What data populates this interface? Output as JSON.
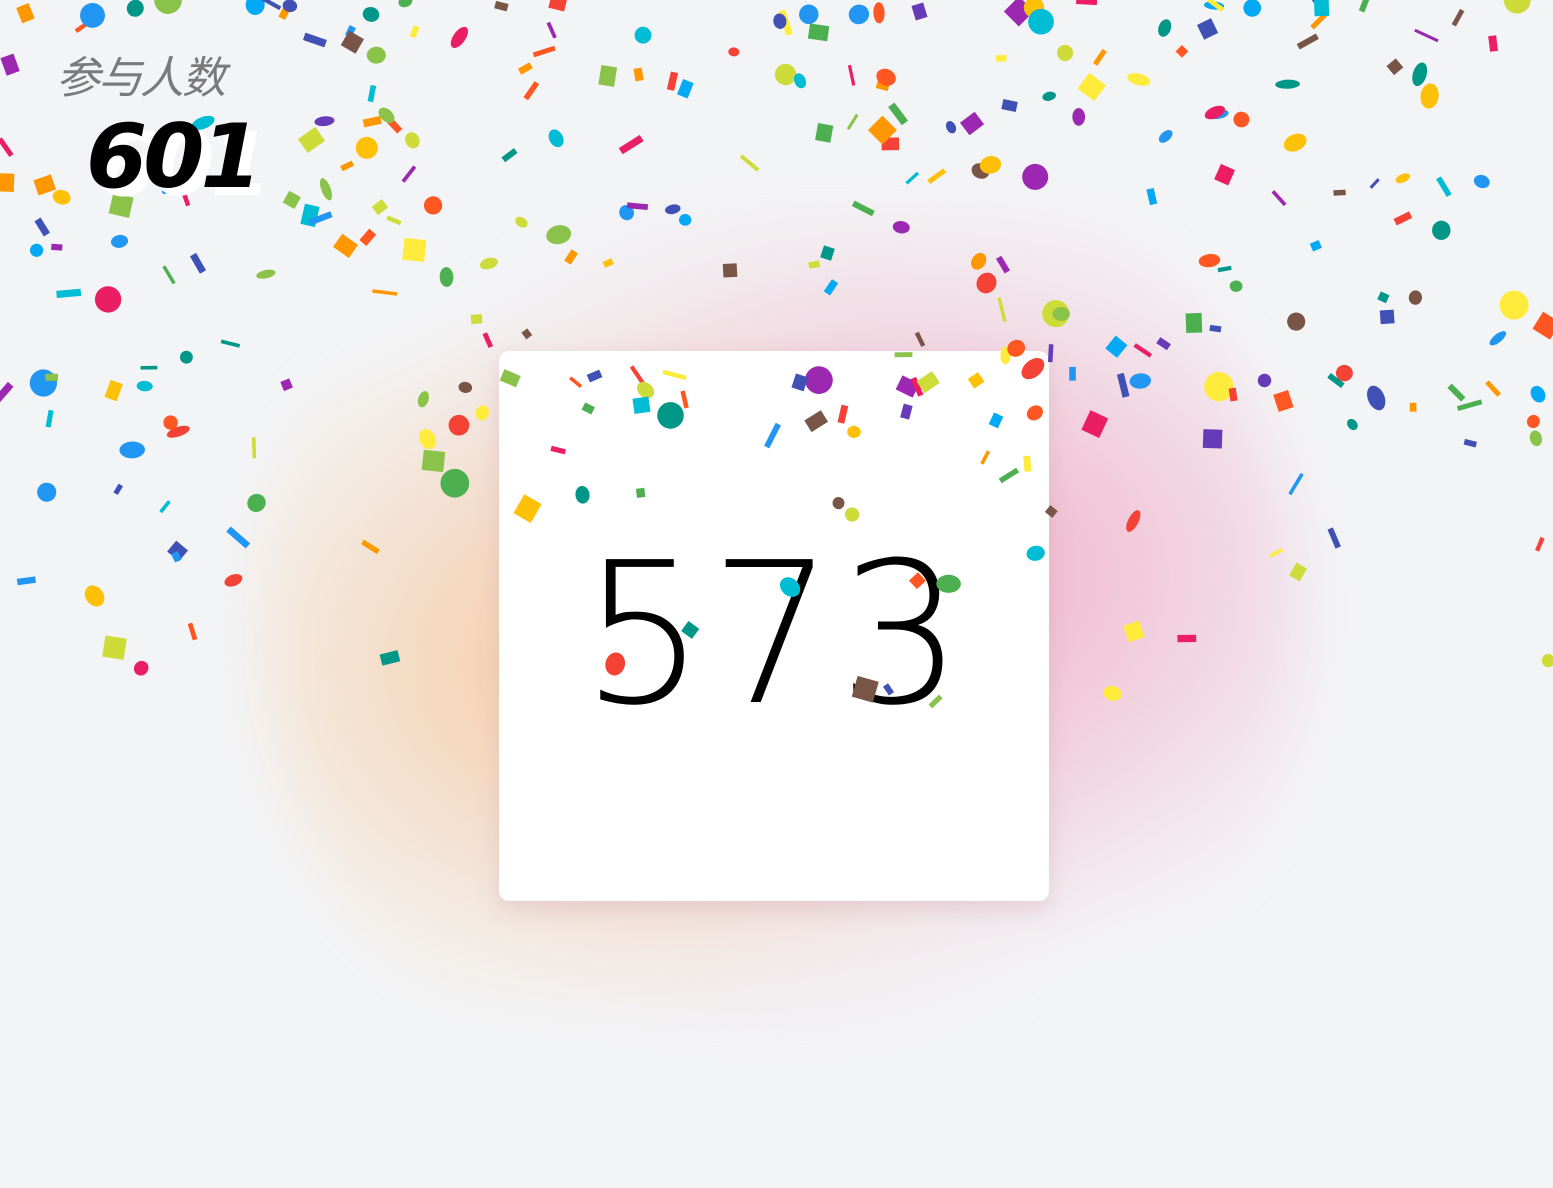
{
  "participants": {
    "label": "参与人数",
    "count": "601"
  },
  "card": {
    "number": "573"
  },
  "colors": {
    "background": "#f3f4f6",
    "card": "#ffffff",
    "confetti_palette": [
      "#3f51b5",
      "#009688",
      "#e91e63",
      "#ffc107",
      "#ff9800",
      "#4caf50",
      "#2196f3",
      "#9c27b0",
      "#673ab7",
      "#795548",
      "#cddc39",
      "#ffeb3b",
      "#f44336",
      "#03a9f4",
      "#00bcd4",
      "#8bc34a",
      "#ff5722"
    ]
  }
}
